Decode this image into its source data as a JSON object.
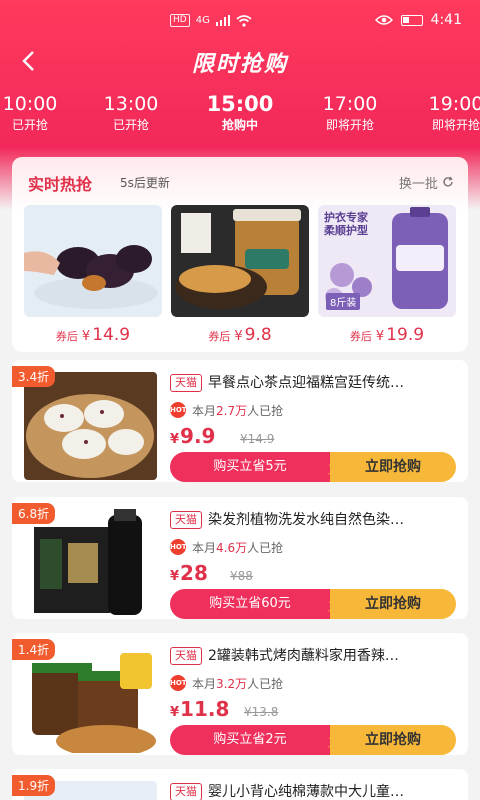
{
  "status_bar": {
    "chip": "HD",
    "network": "4G",
    "time": "4:41"
  },
  "nav": {
    "back_icon": "chevron-left-icon",
    "title": "限时抢购"
  },
  "time_slots": [
    {
      "time": "10:00",
      "status": "已开抢"
    },
    {
      "time": "13:00",
      "status": "已开抢"
    },
    {
      "time": "15:00",
      "status": "抢购中",
      "active": true
    },
    {
      "time": "17:00",
      "status": "即将开抢"
    },
    {
      "time": "19:00",
      "status": "即将开抢"
    }
  ],
  "hot": {
    "title": "实时热抢",
    "subtitle": "5s后更新",
    "swap_label": "换一批",
    "items": [
      {
        "coupon_label": "券后",
        "currency": "¥",
        "price": "14.9"
      },
      {
        "coupon_label": "券后",
        "currency": "¥",
        "price": "9.8"
      },
      {
        "coupon_label": "券后",
        "currency": "¥",
        "price": "19.9"
      }
    ],
    "item3_image_text": {
      "line1": "护衣专家",
      "line2": "柔顺护型",
      "tag": "8斤装"
    }
  },
  "products": [
    {
      "discount": "3.4折",
      "tag": "天猫",
      "title": "早餐点心茶点迎福糕宫廷传统…",
      "sold_prefix": "本月",
      "sold_count": "2.7万",
      "sold_suffix": "人已抢",
      "currency": "¥",
      "price": "9.9",
      "old_price": "¥14.9",
      "save_label": "购买立省5元",
      "buy_label": "立即抢购"
    },
    {
      "discount": "6.8折",
      "tag": "天猫",
      "title": "染发剂植物洗发水纯自然色染…",
      "sold_prefix": "本月",
      "sold_count": "4.6万",
      "sold_suffix": "人已抢",
      "currency": "¥",
      "price": "28",
      "old_price": "¥88",
      "save_label": "购买立省60元",
      "buy_label": "立即抢购"
    },
    {
      "discount": "1.4折",
      "tag": "天猫",
      "title": "2罐装韩式烤肉蘸料家用香辣…",
      "sold_prefix": "本月",
      "sold_count": "3.2万",
      "sold_suffix": "人已抢",
      "currency": "¥",
      "price": "11.8",
      "old_price": "¥13.8",
      "save_label": "购买立省2元",
      "buy_label": "立即抢购"
    },
    {
      "discount": "1.9折",
      "tag": "天猫",
      "title": "婴儿小背心纯棉薄款中大儿童…"
    }
  ],
  "colors": {
    "brand": "#ef2f5c",
    "accent_yellow": "#f7b83a",
    "discount": "#f25b2d"
  }
}
